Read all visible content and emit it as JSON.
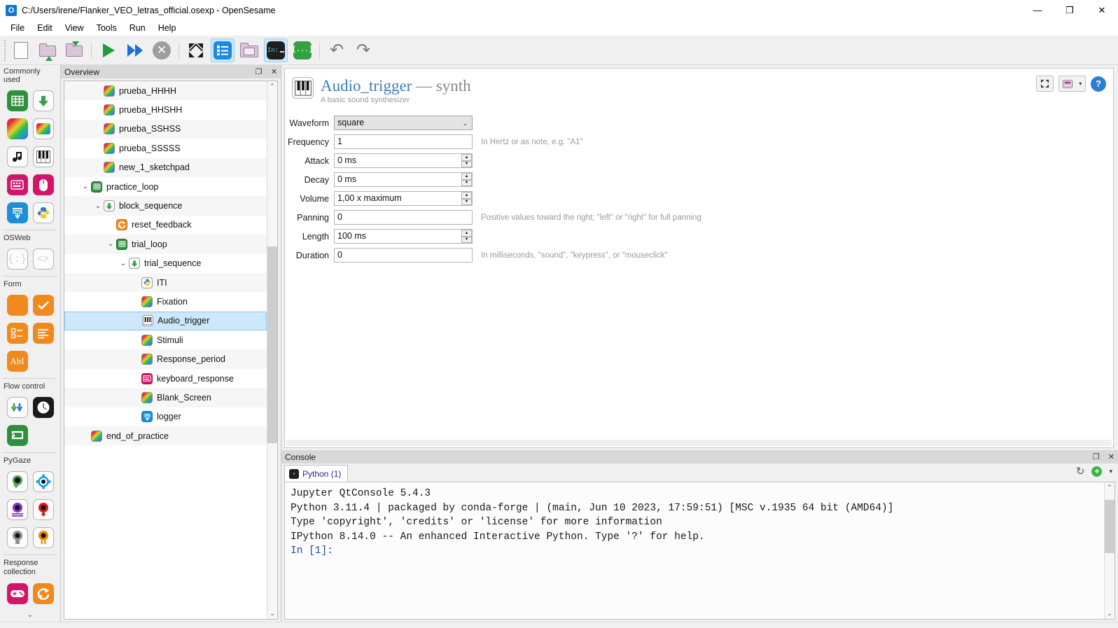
{
  "window": {
    "title": "C:/Users/irene/Flanker_VEO_letras_official.osexp - OpenSesame",
    "app_icon_letter": "O",
    "minimize": "—",
    "maximize": "❐",
    "close": "✕"
  },
  "menubar": {
    "items": [
      "File",
      "Edit",
      "View",
      "Tools",
      "Run",
      "Help"
    ]
  },
  "toolbar": {
    "buttons": [
      {
        "name": "new-file-button",
        "icon": "new-document-icon",
        "active": false
      },
      {
        "name": "open-file-button",
        "icon": "folder-up-icon",
        "active": false
      },
      {
        "name": "save-file-button",
        "icon": "folder-down-icon",
        "active": false
      },
      {
        "name": "run-button",
        "icon": "play-icon",
        "active": false
      },
      {
        "name": "run-in-window-button",
        "icon": "fast-forward-icon",
        "active": false
      },
      {
        "name": "quit-button",
        "icon": "stop-circle-icon",
        "active": false
      },
      {
        "name": "fullscreen-button",
        "icon": "expand-arrows-icon",
        "active": false
      },
      {
        "name": "overview-toggle-button",
        "icon": "list-icon",
        "active": true
      },
      {
        "name": "file-pool-button",
        "icon": "image-folder-icon",
        "active": false
      },
      {
        "name": "console-toggle-button",
        "icon": "console-icon",
        "active": true
      },
      {
        "name": "variable-inspector-button",
        "icon": "brackets-icon",
        "active": false
      },
      {
        "name": "undo-button",
        "icon": "undo-icon",
        "active": false
      },
      {
        "name": "redo-button",
        "icon": "redo-icon",
        "active": false
      }
    ],
    "console_icon_text": "In:",
    "variable_icon_text": "[...]"
  },
  "sidebar": {
    "groups": [
      {
        "label": "Commonly used",
        "items": [
          {
            "name": "item-loop",
            "icon": "loop-table-icon"
          },
          {
            "name": "item-sequence",
            "icon": "sequence-arrow-icon"
          },
          {
            "name": "item-sketchpad",
            "icon": "sketchpad-icon"
          },
          {
            "name": "item-feedback",
            "icon": "feedback-icon"
          },
          {
            "name": "item-sampler",
            "icon": "music-note-icon"
          },
          {
            "name": "item-synth",
            "icon": "piano-icon"
          },
          {
            "name": "item-keyboard-response",
            "icon": "keyboard-icon"
          },
          {
            "name": "item-mouse-response",
            "icon": "mouse-icon"
          },
          {
            "name": "item-logger",
            "icon": "logger-icon"
          },
          {
            "name": "item-inline-script",
            "icon": "python-icon"
          }
        ]
      },
      {
        "label": "OSWeb",
        "items": [
          {
            "name": "item-inline-javascript",
            "icon": "curly-braces-icon"
          },
          {
            "name": "item-inline-html",
            "icon": "angle-brackets-icon"
          }
        ]
      },
      {
        "label": "Form",
        "items": [
          {
            "name": "item-form-base",
            "icon": "form-base-icon"
          },
          {
            "name": "item-form-consent",
            "icon": "form-check-icon"
          },
          {
            "name": "item-form-multiple-choice",
            "icon": "form-choice-icon"
          },
          {
            "name": "item-form-text-display",
            "icon": "form-text-icon"
          },
          {
            "name": "item-form-text-input",
            "icon": "form-abi-icon"
          }
        ]
      },
      {
        "label": "Flow control",
        "items": [
          {
            "name": "item-coroutines",
            "icon": "coroutines-icon"
          },
          {
            "name": "item-advanced-delay",
            "icon": "clock-icon"
          },
          {
            "name": "item-repeat-cycle",
            "icon": "repeat-icon"
          }
        ]
      },
      {
        "label": "PyGaze",
        "items": [
          {
            "name": "item-pygaze-init",
            "icon": "eye-check-icon"
          },
          {
            "name": "item-pygaze-drift-correct",
            "icon": "eye-target-icon"
          },
          {
            "name": "item-pygaze-log",
            "icon": "eye-log-icon"
          },
          {
            "name": "item-pygaze-start-recording",
            "icon": "eye-record-icon"
          },
          {
            "name": "item-pygaze-stop-recording",
            "icon": "eye-stop-icon"
          },
          {
            "name": "item-pygaze-wait",
            "icon": "eye-pause-icon"
          }
        ]
      },
      {
        "label": "Response collection",
        "items": [
          {
            "name": "item-joystick",
            "icon": "gamepad-icon"
          },
          {
            "name": "item-reset-feedback",
            "icon": "reset-feedback-icon"
          }
        ]
      }
    ],
    "more_arrow": "⌄"
  },
  "overview": {
    "title": "Overview",
    "float_button": "❐",
    "close_button": "✕",
    "items": [
      {
        "label": "prueba_HHHH",
        "indent": 3,
        "icon": "sketchpad-icon",
        "twisty": "",
        "selected": false
      },
      {
        "label": "prueba_HHSHH",
        "indent": 3,
        "icon": "sketchpad-icon",
        "twisty": "",
        "selected": false
      },
      {
        "label": "prueba_SSHSS",
        "indent": 3,
        "icon": "sketchpad-icon",
        "twisty": "",
        "selected": false
      },
      {
        "label": "prueba_SSSSS",
        "indent": 3,
        "icon": "sketchpad-icon",
        "twisty": "",
        "selected": false
      },
      {
        "label": "new_1_sketchpad",
        "indent": 3,
        "icon": "sketchpad-icon",
        "twisty": "",
        "selected": false
      },
      {
        "label": "practice_loop",
        "indent": 2,
        "icon": "loop-table-icon",
        "twisty": "⌄",
        "selected": false
      },
      {
        "label": "block_sequence",
        "indent": 3,
        "icon": "sequence-arrow-icon",
        "twisty": "⌄",
        "selected": false
      },
      {
        "label": "reset_feedback",
        "indent": 4,
        "icon": "reset-feedback-icon",
        "twisty": "",
        "selected": false
      },
      {
        "label": "trial_loop",
        "indent": 4,
        "icon": "loop-table-icon",
        "twisty": "⌄",
        "selected": false
      },
      {
        "label": "trial_sequence",
        "indent": 5,
        "icon": "sequence-arrow-icon",
        "twisty": "⌄",
        "selected": false
      },
      {
        "label": "ITI",
        "indent": 6,
        "icon": "python-icon",
        "twisty": "",
        "selected": false
      },
      {
        "label": "Fixation",
        "indent": 6,
        "icon": "sketchpad-icon",
        "twisty": "",
        "selected": false
      },
      {
        "label": "Audio_trigger",
        "indent": 6,
        "icon": "piano-icon",
        "twisty": "",
        "selected": true
      },
      {
        "label": "Stimuli",
        "indent": 6,
        "icon": "sketchpad-icon",
        "twisty": "",
        "selected": false
      },
      {
        "label": "Response_period",
        "indent": 6,
        "icon": "sketchpad-icon",
        "twisty": "",
        "selected": false
      },
      {
        "label": "keyboard_response",
        "indent": 6,
        "icon": "keyboard-icon",
        "twisty": "",
        "selected": false
      },
      {
        "label": "Blank_Screen",
        "indent": 6,
        "icon": "sketchpad-icon",
        "twisty": "",
        "selected": false
      },
      {
        "label": "logger",
        "indent": 6,
        "icon": "logger-icon",
        "twisty": "",
        "selected": false
      },
      {
        "label": "end_of_practice",
        "indent": 2,
        "icon": "sketchpad-icon",
        "twisty": "",
        "selected": false
      }
    ],
    "scroll_up": "⌃",
    "scroll_down": "⌄"
  },
  "editor": {
    "item_name": "Audio_trigger",
    "separator": "—",
    "item_type": "synth",
    "description": "A basic sound synthesizer",
    "icon": "piano-icon",
    "header_buttons": {
      "fullscreen": "⤢",
      "view_toggle": "▤",
      "view_caret": "▾",
      "help": "?"
    },
    "fields": [
      {
        "label": "Waveform",
        "kind": "select",
        "value": "square",
        "hint": "",
        "name": "waveform"
      },
      {
        "label": "Frequency",
        "kind": "text",
        "value": "1",
        "hint": "In Hertz or as note, e.g. \"A1\"",
        "name": "frequency"
      },
      {
        "label": "Attack",
        "kind": "spin",
        "value": "0 ms",
        "hint": "",
        "name": "attack"
      },
      {
        "label": "Decay",
        "kind": "spin",
        "value": "0 ms",
        "hint": "",
        "name": "decay"
      },
      {
        "label": "Volume",
        "kind": "spin",
        "value": "1,00 x maximum",
        "hint": "",
        "name": "volume"
      },
      {
        "label": "Panning",
        "kind": "text",
        "value": "0",
        "hint": "Positive values toward the right; \"left\" or \"right\" for full panning",
        "name": "panning"
      },
      {
        "label": "Length",
        "kind": "spin",
        "value": "100 ms",
        "hint": "",
        "name": "length"
      },
      {
        "label": "Duration",
        "kind": "text",
        "value": "0",
        "hint": "In milliseconds, \"sound\", \"keypress\", or \"mouseclick\"",
        "name": "duration"
      }
    ]
  },
  "console": {
    "title": "Console",
    "float_button": "❐",
    "close_button": "✕",
    "tab_label": "Python (1)",
    "refresh_icon": "↻",
    "add_icon": "+",
    "caret_icon": "▾",
    "lines": [
      "Jupyter QtConsole 5.4.3",
      "Python 3.11.4 | packaged by conda-forge | (main, Jun 10 2023, 17:59:51) [MSC v.1935 64 bit (AMD64)]",
      "Type 'copyright', 'credits' or 'license' for more information",
      "IPython 8.14.0 -- An enhanced Interactive Python. Type '?' for help.",
      ""
    ],
    "prompt": "In [1]:"
  },
  "colors": {
    "accent_blue": "#1c8ae0",
    "selection_blue": "#cde8fb",
    "title_blue": "#3a7cb8",
    "green": "#33a13f",
    "orange": "#f08a1e",
    "magenta": "#d81b60"
  }
}
